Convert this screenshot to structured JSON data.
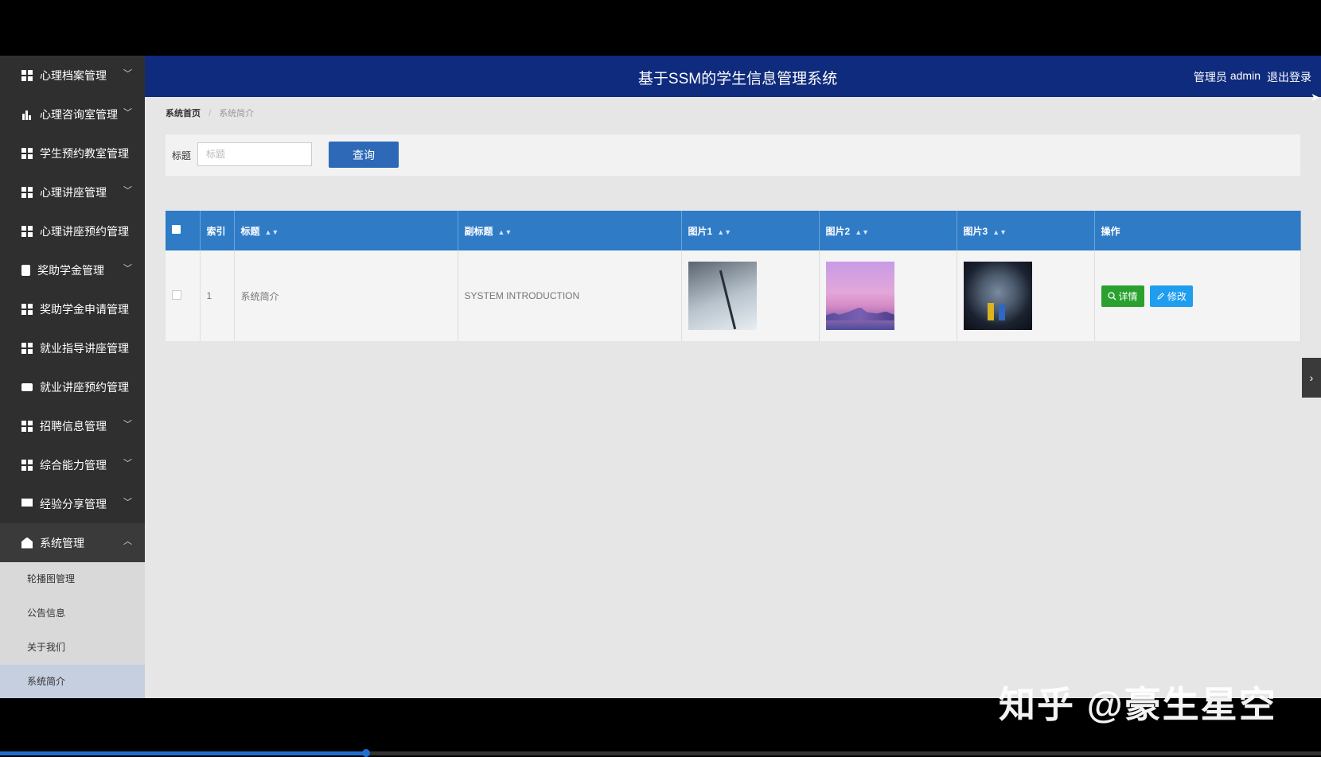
{
  "app_title": "基于SSM的学生信息管理系统",
  "user": {
    "role": "管理员",
    "name": "admin",
    "logout": "退出登录"
  },
  "sidebar": {
    "items": [
      {
        "label": "心理档案管理",
        "icon": "grid-icon",
        "chevron": "﹀"
      },
      {
        "label": "心理咨询室管理",
        "icon": "bar-chart-icon",
        "chevron": "﹀"
      },
      {
        "label": "学生预约教室管理",
        "icon": "grid-icon",
        "chevron": ""
      },
      {
        "label": "心理讲座管理",
        "icon": "grid-icon",
        "chevron": "﹀"
      },
      {
        "label": "心理讲座预约管理",
        "icon": "grid-icon",
        "chevron": ""
      },
      {
        "label": "奖助学金管理",
        "icon": "clipboard-icon",
        "chevron": "﹀"
      },
      {
        "label": "奖助学金申请管理",
        "icon": "grid-icon",
        "chevron": ""
      },
      {
        "label": "就业指导讲座管理",
        "icon": "grid-icon",
        "chevron": ""
      },
      {
        "label": "就业讲座预约管理",
        "icon": "chat-icon",
        "chevron": ""
      },
      {
        "label": "招聘信息管理",
        "icon": "grid-icon",
        "chevron": "﹀"
      },
      {
        "label": "综合能力管理",
        "icon": "grid-icon",
        "chevron": "﹀"
      },
      {
        "label": "经验分享管理",
        "icon": "monitor-icon",
        "chevron": "﹀"
      },
      {
        "label": "系统管理",
        "icon": "home-icon",
        "chevron": "︿"
      }
    ],
    "submenu": [
      "轮播图管理",
      "公告信息",
      "关于我们",
      "系统简介"
    ]
  },
  "breadcrumb": {
    "home": "系统首页",
    "separator": "/",
    "current": "系统简介"
  },
  "search": {
    "label": "标题",
    "placeholder": "标题",
    "value": "",
    "button": "查询"
  },
  "table": {
    "columns": [
      "索引",
      "标题",
      "副标题",
      "图片1",
      "图片2",
      "图片3",
      "操作"
    ],
    "sortable": [
      false,
      true,
      true,
      true,
      true,
      true,
      false
    ],
    "rows": [
      {
        "index": "1",
        "title": "系统简介",
        "subtitle": "SYSTEM INTRODUCTION",
        "images": [
          "wind-turbine-photo",
          "city-skyline-photo",
          "earth-figures-photo"
        ]
      }
    ],
    "actions": {
      "detail": "详情",
      "edit": "修改"
    }
  },
  "colors": {
    "header": "#0f2b7d",
    "sidebar": "#2f2f2f",
    "table_header": "#2f7bc6",
    "primary_button": "#2e69b8",
    "detail_button": "#2aa12e",
    "edit_button": "#1f9ef0"
  },
  "watermark": "知乎 @豪生星空",
  "video_progress": 0.277
}
